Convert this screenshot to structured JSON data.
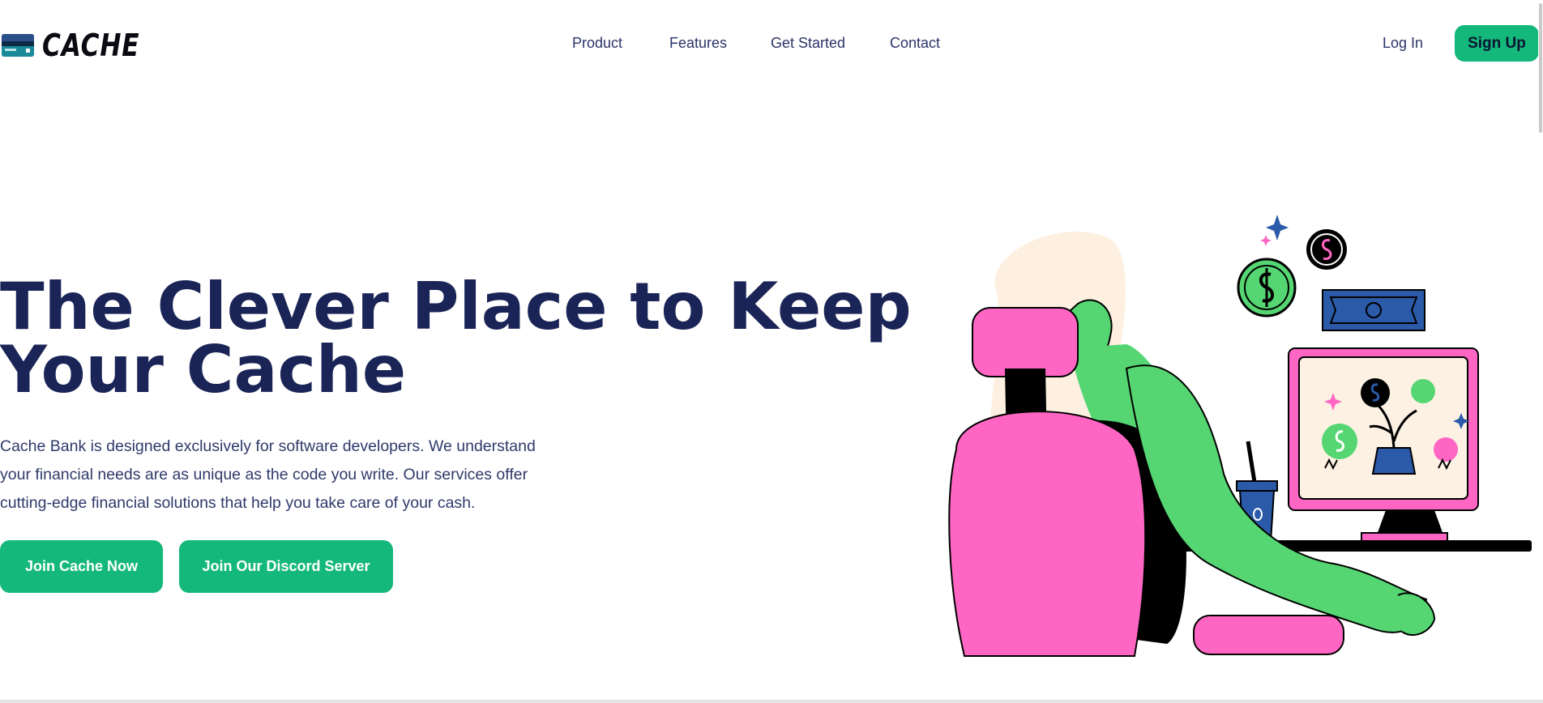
{
  "brand": {
    "name": "CACHE",
    "logo_icon": "credit-card-icon"
  },
  "nav": {
    "links": [
      "Product",
      "Features",
      "Get Started",
      "Contact"
    ],
    "login": "Log In",
    "signup": "Sign Up"
  },
  "hero": {
    "title_line1": "The Clever Place to Keep",
    "title_line2": "Your Cache",
    "description": "Cache Bank is designed exclusively for software developers. We understand your financial needs are as unique as the code you write. Our services offer cutting-edge financial solutions that help you take care of your cash.",
    "buttons": [
      "Join Cache Now",
      "Join Our Discord Server"
    ]
  },
  "colors": {
    "accent": "#14b87a",
    "heading": "#1b2456",
    "illustration_green": "#55d672",
    "illustration_pink": "#ff66c4",
    "illustration_blue": "#2a5aa8"
  }
}
